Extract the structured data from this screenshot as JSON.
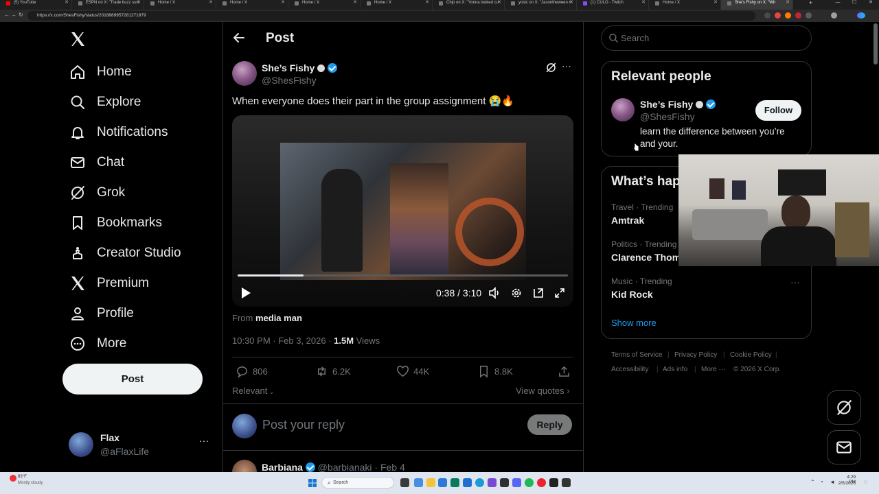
{
  "browser": {
    "tabs": [
      {
        "title": "(5) YouTube",
        "icon_color": "#ff0000",
        "active": false
      },
      {
        "title": "ESPN on X: \"Trade buzz surr",
        "icon_color": "#888888",
        "active": false
      },
      {
        "title": "Home / X",
        "icon_color": "#888888",
        "active": false
      },
      {
        "title": "Home / X",
        "icon_color": "#888888",
        "active": false
      },
      {
        "title": "Home / X",
        "icon_color": "#888888",
        "active": false
      },
      {
        "title": "Home / X",
        "icon_color": "#888888",
        "active": false
      },
      {
        "title": "Chip on X: \"Yonna looked cu",
        "icon_color": "#888888",
        "active": false
      },
      {
        "title": "yosic on X: \"Jasontheween n",
        "icon_color": "#888888",
        "active": false
      },
      {
        "title": "(1) CULO - Twitch",
        "icon_color": "#9146ff",
        "active": false
      },
      {
        "title": "Home / X",
        "icon_color": "#888888",
        "active": false
      },
      {
        "title": "She's Fishy on X: \"Wh",
        "icon_color": "#888888",
        "active": true
      }
    ],
    "url": "https://x.com/ShesFishy/status/2018889957281271879"
  },
  "nav": {
    "items": [
      {
        "label": "Home",
        "icon": "home-icon"
      },
      {
        "label": "Explore",
        "icon": "search-icon"
      },
      {
        "label": "Notifications",
        "icon": "bell-icon"
      },
      {
        "label": "Chat",
        "icon": "mail-icon"
      },
      {
        "label": "Grok",
        "icon": "grok-icon"
      },
      {
        "label": "Bookmarks",
        "icon": "bookmark-icon"
      },
      {
        "label": "Creator Studio",
        "icon": "creator-studio-icon"
      },
      {
        "label": "Premium",
        "icon": "x-logo-icon"
      },
      {
        "label": "Profile",
        "icon": "person-icon"
      },
      {
        "label": "More",
        "icon": "more-circle-icon"
      }
    ],
    "post_button": "Post",
    "account": {
      "name": "Flax",
      "handle": "@aFlaxLife",
      "more": "···"
    }
  },
  "header": {
    "title": "Post",
    "back": "←"
  },
  "post": {
    "author_name": "She’s Fishy",
    "author_handle": "@ShesFishy",
    "text": "When everyone does their part in the group assignment 😭🔥",
    "video": {
      "time": "0:38 / 3:10",
      "progress": 0.2
    },
    "from_label": "From",
    "from_source": "media man",
    "timestamp": "10:30 PM · Feb 3, 2026 · ",
    "views_count": "1.5M",
    "views_label": " Views",
    "stats": {
      "replies": "806",
      "reposts": "6.2K",
      "likes": "44K",
      "bookmarks": "8.8K"
    },
    "sort_label": "Relevant",
    "view_quotes": "View quotes",
    "reply_placeholder": "Post your reply",
    "reply_button": "Reply",
    "more": "···"
  },
  "next_reply": {
    "name": "Barbiana",
    "handle": "@barbianaki",
    "date": "· Feb 4"
  },
  "sidebar": {
    "search_placeholder": "Search",
    "relevant_title": "Relevant people",
    "person": {
      "name": "She’s Fishy",
      "handle": "@ShesFishy",
      "follow": "Follow",
      "bio": "learn the difference between you’re and your."
    },
    "happening_title": "What’s hap",
    "trends": [
      {
        "category": "Travel · Trending",
        "name": "Amtrak"
      },
      {
        "category": "Politics · Trending",
        "name": "Clarence Thoma"
      },
      {
        "category": "Music · Trending",
        "name": "Kid Rock"
      }
    ],
    "show_more": "Show more",
    "footer": [
      "Terms of Service",
      "Privacy Policy",
      "Cookie Policy",
      "Accessibility",
      "Ads info",
      "More ···",
      "© 2026 X Corp."
    ]
  },
  "taskbar": {
    "weather_temp": "83°F",
    "weather_desc": "Mostly cloudy",
    "search": "Search",
    "time": "4:29 PM",
    "date": "2/5/2026"
  },
  "colors": {
    "accent": "#1d9bf0",
    "border": "#2f3336",
    "muted": "#71767b",
    "text": "#e7e9ea"
  }
}
